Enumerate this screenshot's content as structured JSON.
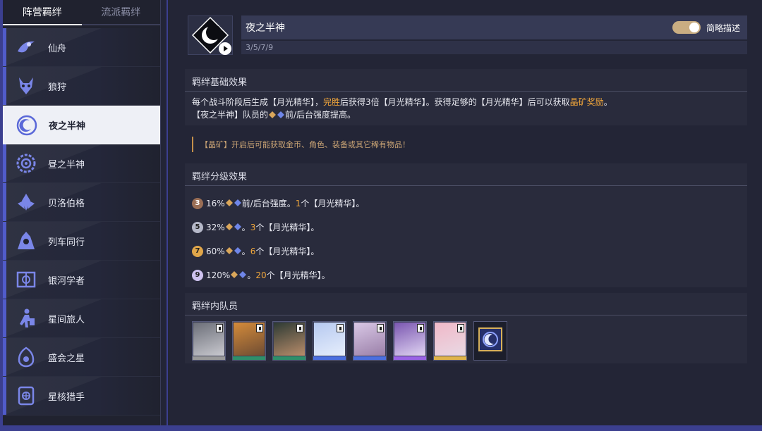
{
  "sidebar": {
    "tabs": [
      {
        "label": "阵营羁绊",
        "active": true
      },
      {
        "label": "流派羁绊",
        "active": false
      }
    ],
    "items": [
      {
        "label": "仙舟",
        "icon": "xianzhou-icon"
      },
      {
        "label": "狼狩",
        "icon": "wolf-icon"
      },
      {
        "label": "夜之半神",
        "icon": "moon-icon",
        "active": true
      },
      {
        "label": "昼之半神",
        "icon": "sun-icon"
      },
      {
        "label": "贝洛伯格",
        "icon": "belobog-icon"
      },
      {
        "label": "列车同行",
        "icon": "train-icon"
      },
      {
        "label": "银河学者",
        "icon": "scholar-icon"
      },
      {
        "label": "星间旅人",
        "icon": "traveler-icon"
      },
      {
        "label": "盛会之星",
        "icon": "festival-star-icon"
      },
      {
        "label": "星核猎手",
        "icon": "stellaron-hunter-icon"
      }
    ]
  },
  "header": {
    "emblem_icon": "crescent-moon-icon",
    "title": "夜之半神",
    "counts": "3/5/7/9",
    "toggle_label": "简略描述",
    "toggle_on": true
  },
  "basic_effect": {
    "heading": "羁绊基础效果",
    "line1_a": "每个战斗阶段后生成【月光精华】，",
    "line1_b": "完胜",
    "line1_c": "后获得3倍【月光精华】。获得足够的【月光精华】后可以获取",
    "line1_d": "晶矿奖励",
    "line1_e": "。",
    "line2_a": "【夜之半神】队员的",
    "line2_b": "前/后台强度提高。"
  },
  "note": "【晶矿】开启后可能获取金币、角色、装备或其它稀有物品！",
  "tiers": {
    "heading": "羁绊分级效果",
    "rows": [
      {
        "tier": "3",
        "pct": "16%",
        "text": "前/后台强度。",
        "count": "1",
        "tail": "个【月光精华】。",
        "color": "#9a6e55"
      },
      {
        "tier": "5",
        "pct": "32%",
        "text": "。",
        "count": "3",
        "tail": "个【月光精华】。",
        "color": "#b5b8c8"
      },
      {
        "tier": "7",
        "pct": "60%",
        "text": "。",
        "count": "6",
        "tail": "个【月光精华】。",
        "color": "#e0a64a"
      },
      {
        "tier": "9",
        "pct": "120%",
        "text": "。",
        "count": "20",
        "tail": "个【月光精华】。",
        "color": "#cfc3f0"
      }
    ]
  },
  "members": {
    "heading": "羁绊内队员",
    "list": [
      {
        "name": "member-1",
        "rarity_color": "#9a9a9a",
        "art": [
          "#6b6e78",
          "#c9c9cf"
        ]
      },
      {
        "name": "member-2",
        "rarity_color": "#2f8f6a",
        "art": [
          "#d48b3a",
          "#6e4c33"
        ]
      },
      {
        "name": "member-3",
        "rarity_color": "#2f8f6a",
        "art": [
          "#2d3a34",
          "#b88c6a"
        ]
      },
      {
        "name": "member-4",
        "rarity_color": "#4b6fe0",
        "art": [
          "#b6c9f0",
          "#e6eefc"
        ]
      },
      {
        "name": "member-5",
        "rarity_color": "#4b6fe0",
        "art": [
          "#d9c8e6",
          "#9a7fa8"
        ]
      },
      {
        "name": "member-6",
        "rarity_color": "#9a63e6",
        "art": [
          "#7a56b0",
          "#e0d4f2"
        ]
      },
      {
        "name": "member-7",
        "rarity_color": "#e0b44a",
        "art": [
          "#f0b8c8",
          "#e9d9e4"
        ]
      }
    ],
    "item_icon": "moon-crystal-icon"
  },
  "colors": {
    "accent": "#3b3f8f",
    "highlight": "#f2a73b",
    "note": "#c9a374"
  }
}
